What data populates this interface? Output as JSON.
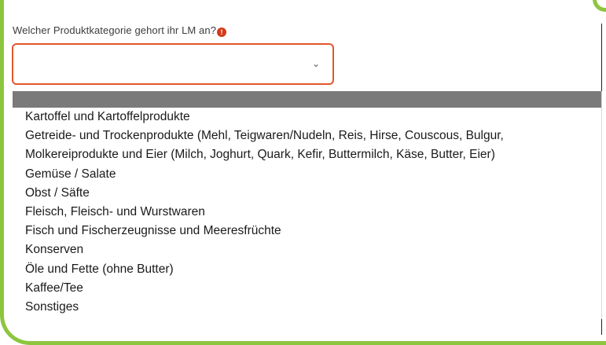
{
  "form": {
    "question_label": "Welcher Produktkategorie gehort ihr LM an?",
    "required_mark": "!",
    "select_value": "",
    "chevron_icon": "chevron-down-icon"
  },
  "dropdown": {
    "options": [
      "Kartoffel und Kartoffelprodukte",
      "Getreide- und Trockenprodukte (Mehl, Teigwaren/Nudeln, Reis, Hirse, Couscous, Bulgur,",
      "Molkereiprodukte und Eier (Milch, Joghurt, Quark, Kefir, Buttermilch, Käse, Butter, Eier)",
      "Gemüse / Salate",
      "Obst / Säfte",
      "Fleisch, Fleisch- und Wurstwaren",
      "Fisch und Fischerzeugnisse und Meeresfrüchte",
      "Konserven",
      "Öle und Fette (ohne Butter)",
      "Kaffee/Tee",
      "Sonstiges"
    ]
  },
  "colors": {
    "frame_accent": "#8cc63f",
    "select_border": "#e2572b",
    "required_icon": "#d33a1a",
    "highlight_row": "#7a7a7a"
  }
}
